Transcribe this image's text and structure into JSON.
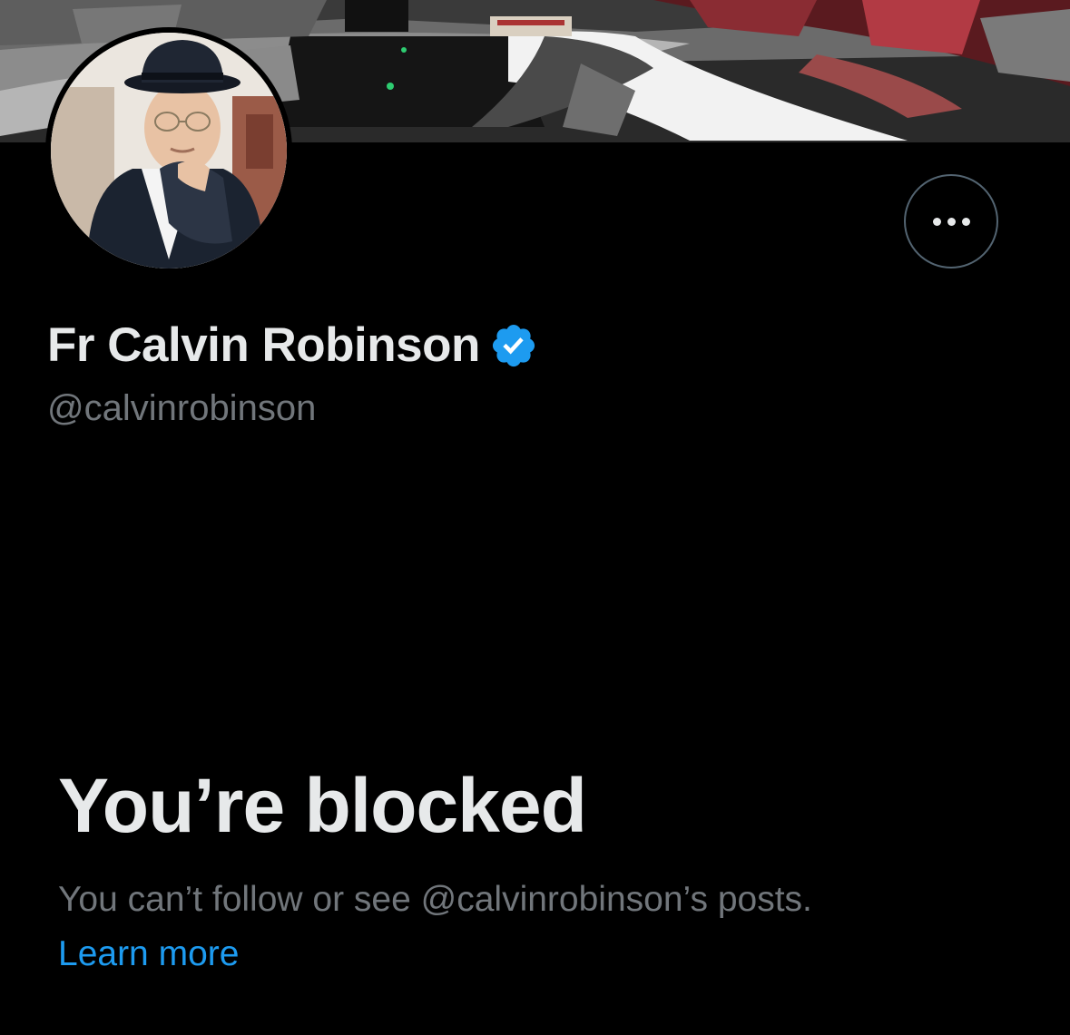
{
  "profile": {
    "display_name": "Fr Calvin Robinson",
    "handle": "@calvinrobinson",
    "verified": true
  },
  "actions": {
    "more_icon": "ellipsis-icon"
  },
  "blocked": {
    "title": "You’re blocked",
    "description": "You can’t follow or see @calvinrobinson’s posts.",
    "learn_more": "Learn more"
  },
  "colors": {
    "background": "#000000",
    "primary_text": "#e7e9ea",
    "secondary_text": "#71767b",
    "link": "#1d9bf0",
    "verified_badge": "#1d9bf0",
    "button_border": "#536471"
  }
}
